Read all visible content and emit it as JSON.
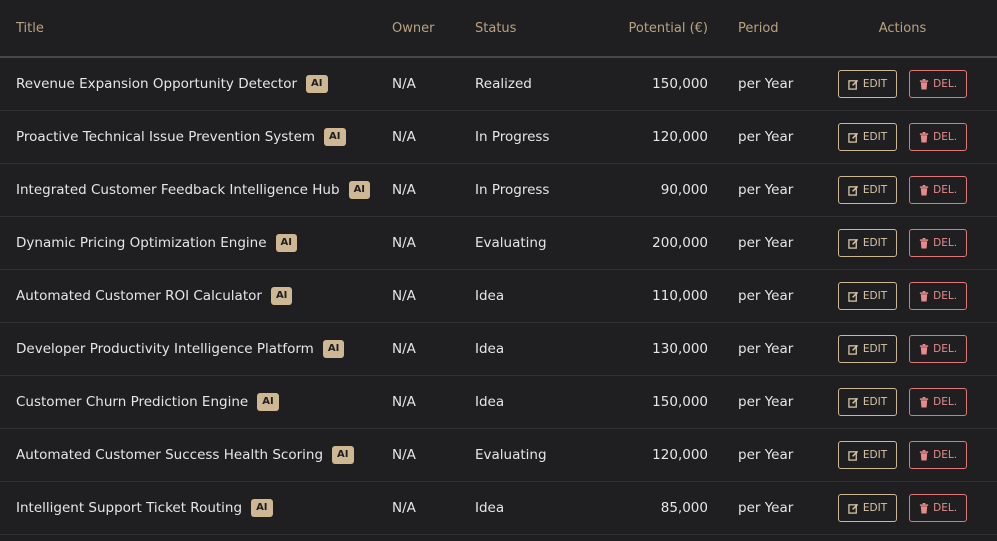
{
  "table": {
    "headers": {
      "title": "Title",
      "owner": "Owner",
      "status": "Status",
      "potential": "Potential (€)",
      "period": "Period",
      "actions": "Actions"
    },
    "badge_label": "AI",
    "edit_label": "EDIT",
    "delete_label": "DEL.",
    "rows": [
      {
        "title": "Revenue Expansion Opportunity Detector",
        "owner": "N/A",
        "status": "Realized",
        "potential": "150,000",
        "period": "per Year"
      },
      {
        "title": "Proactive Technical Issue Prevention System",
        "owner": "N/A",
        "status": "In Progress",
        "potential": "120,000",
        "period": "per Year"
      },
      {
        "title": "Integrated Customer Feedback Intelligence Hub",
        "owner": "N/A",
        "status": "In Progress",
        "potential": "90,000",
        "period": "per Year"
      },
      {
        "title": "Dynamic Pricing Optimization Engine",
        "owner": "N/A",
        "status": "Evaluating",
        "potential": "200,000",
        "period": "per Year"
      },
      {
        "title": "Automated Customer ROI Calculator",
        "owner": "N/A",
        "status": "Idea",
        "potential": "110,000",
        "period": "per Year"
      },
      {
        "title": "Developer Productivity Intelligence Platform",
        "owner": "N/A",
        "status": "Idea",
        "potential": "130,000",
        "period": "per Year"
      },
      {
        "title": "Customer Churn Prediction Engine",
        "owner": "N/A",
        "status": "Idea",
        "potential": "150,000",
        "period": "per Year"
      },
      {
        "title": "Automated Customer Success Health Scoring",
        "owner": "N/A",
        "status": "Evaluating",
        "potential": "120,000",
        "period": "per Year"
      },
      {
        "title": "Intelligent Support Ticket Routing",
        "owner": "N/A",
        "status": "Idea",
        "potential": "85,000",
        "period": "per Year"
      }
    ]
  },
  "colors": {
    "background": "#1f1f21",
    "header_text": "#b8a37f",
    "accent": "#cdb893",
    "danger": "#e07878"
  },
  "icons": {
    "edit": "edit-icon",
    "delete": "trash-icon"
  }
}
